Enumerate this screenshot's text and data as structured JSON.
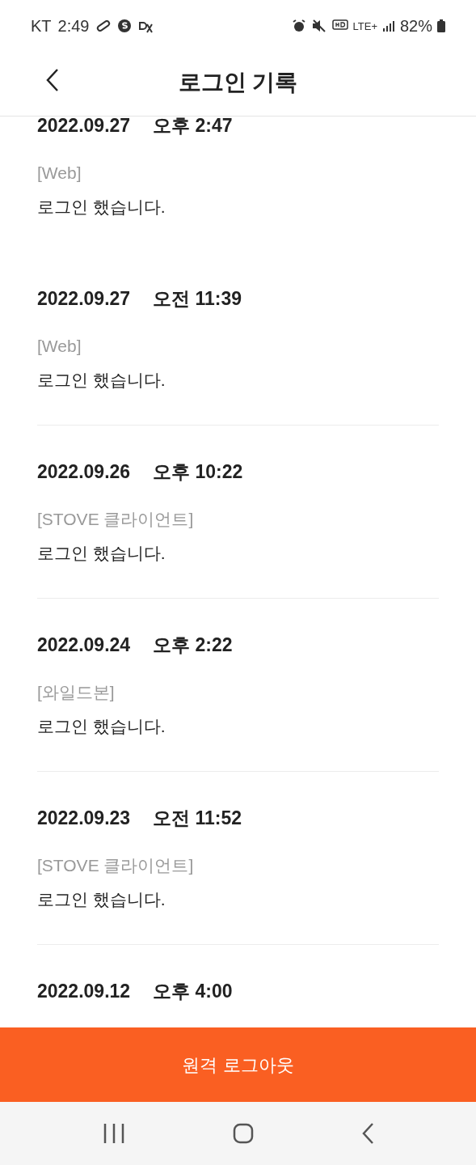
{
  "status_bar": {
    "carrier": "KT",
    "time": "2:49",
    "network": "LTE+",
    "battery": "82%"
  },
  "header": {
    "title": "로그인 기록"
  },
  "entries": [
    {
      "date": "2022.09.27",
      "time": "오후 2:47",
      "source": "[Web]",
      "message": "로그인 했습니다."
    },
    {
      "date": "2022.09.27",
      "time": "오전 11:39",
      "source": "[Web]",
      "message": "로그인 했습니다."
    },
    {
      "date": "2022.09.26",
      "time": "오후 10:22",
      "source": "[STOVE 클라이언트]",
      "message": "로그인 했습니다."
    },
    {
      "date": "2022.09.24",
      "time": "오후 2:22",
      "source": "[와일드본]",
      "message": "로그인 했습니다."
    },
    {
      "date": "2022.09.23",
      "time": "오전 11:52",
      "source": "[STOVE 클라이언트]",
      "message": "로그인 했습니다."
    },
    {
      "date": "2022.09.12",
      "time": "오후 4:00"
    }
  ],
  "action_button": {
    "label": "원격 로그아웃"
  }
}
